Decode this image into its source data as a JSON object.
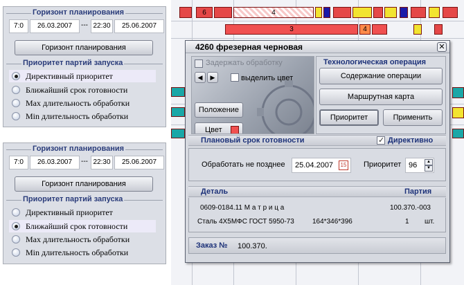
{
  "panel1": {
    "horizon_title": "Горизонт планирования",
    "start_time": "7:0",
    "start_date": "26.03.2007",
    "range_sep": "---",
    "end_time": "22:30",
    "end_date": "25.06.2007",
    "horizon_button": "Горизонт планирования",
    "priority_title": "Приоритет партий запуска",
    "options": [
      "Директивный приоритет",
      "Ближайший срок готовности",
      "Max длительность обработки",
      "Min  длительность обработки"
    ]
  },
  "panel2": {
    "horizon_title": "Горизонт планирования",
    "start_time": "7:0",
    "start_date": "26.03.2007",
    "range_sep": "---",
    "end_time": "22:30",
    "end_date": "25.06.2007",
    "horizon_button": "Горизонт планирования",
    "priority_title": "Приоритет партий запуска",
    "options": [
      "Директивный приоритет",
      "Ближайший срок готовности",
      "Max длительность обработки",
      "Min  длительность обработки"
    ]
  },
  "gantt": {
    "labels": [
      "6",
      "4",
      "3",
      "4"
    ]
  },
  "dialog": {
    "title": "4260 фрезерная черновая",
    "close": "✕",
    "hold_label": "Задержать обработку",
    "highlight_label": "выделить цвет",
    "nav_left": "◀",
    "nav_right": "▶",
    "position_button": "Положение",
    "color_button": "Цвет",
    "tech_op_title": "Технологическая операция",
    "op_content_button": "Содержание операции",
    "route_card_button": "Маршрутная  карта",
    "priority_button": "Приоритет",
    "apply_button": "Применить",
    "deadline_title": "Плановый срок готовности",
    "directive_label": "Директивно",
    "process_before_label": "Обработать не позднее",
    "process_before_value": "25.04.2007",
    "priority_label": "Приоритет",
    "priority_value": "96",
    "detail_header": "Деталь",
    "batch_header": "Партия",
    "detail_name": "0609-0184.11 М а т р и ц а",
    "batch_number": "100.370.-003",
    "material": "Сталь 4Х5МФС ГОСТ 5950-73",
    "dimensions": "164*346*396",
    "quantity": "1",
    "unit": "шт.",
    "order_label": "Заказ №",
    "order_value": "100.370."
  },
  "colors": {
    "bar_red": "#f05050",
    "bar_orange": "#ff8a4a",
    "accent_teal": "#1aa7a7",
    "title_blue": "#1d3279"
  }
}
